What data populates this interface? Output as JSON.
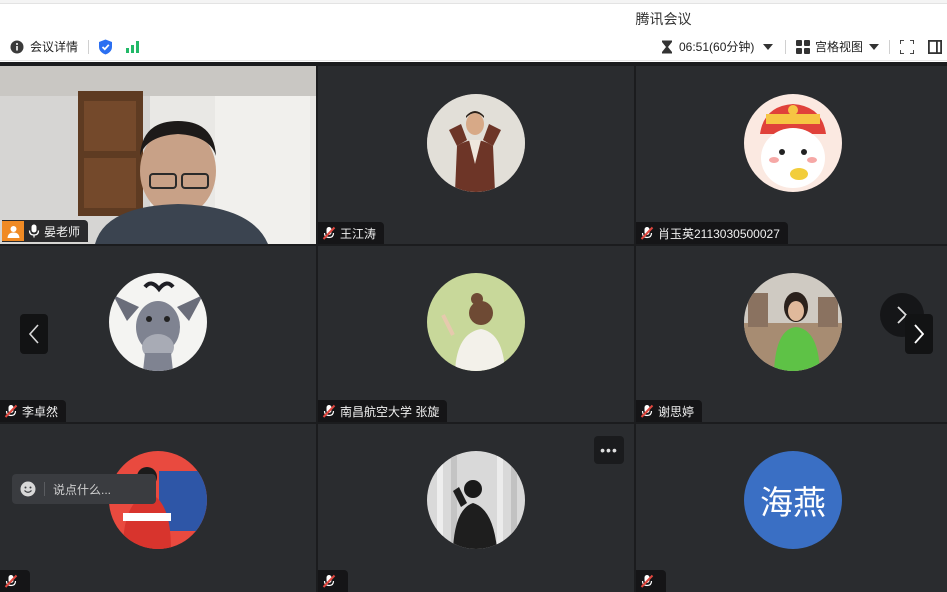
{
  "app": {
    "title": "腾讯会议"
  },
  "toolbar": {
    "meeting_info_label": "会议详情",
    "timer_text": "06:51(60分钟)",
    "view_label": "宫格视图"
  },
  "participants": [
    {
      "name": "晏老师",
      "mic": "on",
      "active": true
    },
    {
      "name": "王江涛",
      "mic": "muted"
    },
    {
      "name": "肖玉英2113030500027",
      "mic": "muted"
    },
    {
      "name": "李卓然",
      "mic": "muted"
    },
    {
      "name": "南昌航空大学 张旋",
      "mic": "muted"
    },
    {
      "name": "谢思婷",
      "mic": "muted"
    },
    {
      "name": "",
      "mic": "muted"
    },
    {
      "name": "",
      "mic": "muted"
    },
    {
      "name": "",
      "mic": "muted"
    }
  ],
  "avatar_text": {
    "haiyan": "海燕"
  },
  "chat": {
    "placeholder": "说点什么..."
  },
  "colors": {
    "active_border": "#1fc366",
    "tile_bg": "#2a2c2f",
    "muted_mic": "#e0473f",
    "haiyan_avatar": "#3a6fc4"
  }
}
